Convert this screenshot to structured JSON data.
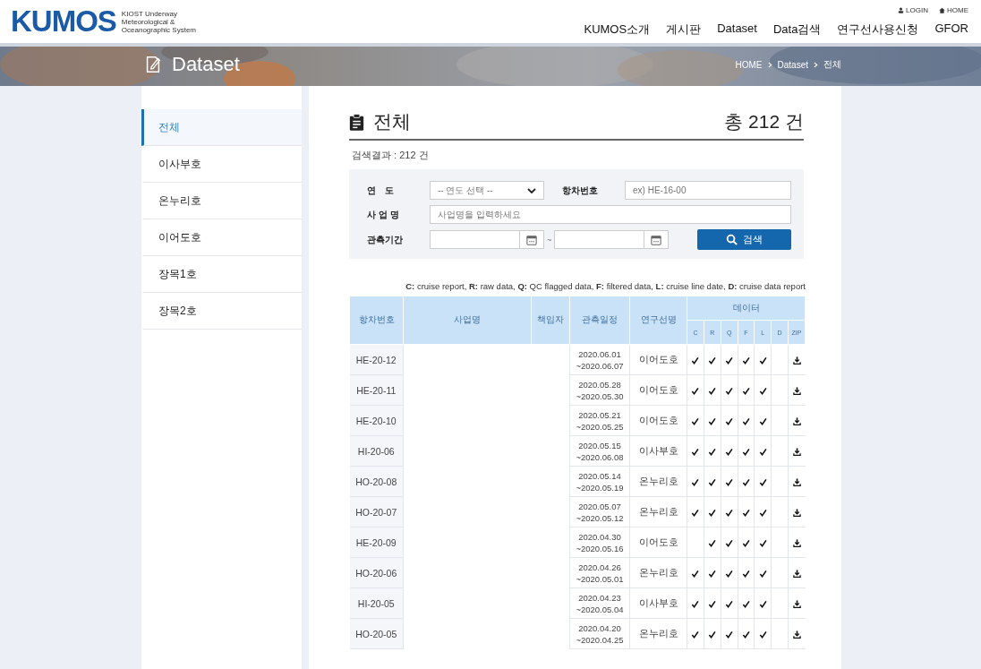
{
  "header": {
    "logo": "KUMOS",
    "logo_subtitle": [
      "KIOST Underway",
      "Meteorological &",
      "Oceanographic System"
    ],
    "top_links": [
      "LOGIN",
      "HOME"
    ],
    "nav": [
      "KUMOS소개",
      "게시판",
      "Dataset",
      "Data검색",
      "연구선사용신청",
      "GFOR"
    ]
  },
  "banner": {
    "title": "Dataset",
    "breadcrumb": [
      "HOME",
      "Dataset",
      "전체"
    ]
  },
  "sidebar": {
    "items": [
      {
        "label": "전체",
        "selected": true
      },
      {
        "label": "이사부호",
        "selected": false
      },
      {
        "label": "온누리호",
        "selected": false
      },
      {
        "label": "이어도호",
        "selected": false
      },
      {
        "label": "장목1호",
        "selected": false
      },
      {
        "label": "장목2호",
        "selected": false
      }
    ]
  },
  "page": {
    "title": "전체",
    "total": "총 212 건",
    "result_count": "검색결과 : 212 건"
  },
  "search": {
    "year_label": "연　도",
    "year_select": "-- 연도 선택 --",
    "cruise_label": "항차번호",
    "cruise_placeholder": "ex) HE-16-00",
    "project_label": "사 업 명",
    "project_placeholder": "사업명을 입력하세요",
    "period_label": "관측기간",
    "range_sep": "~",
    "button": "검색"
  },
  "legend": "**C:** cruise report, **R:** raw data, **Q:** QC flagged data, **F:** filtered data, **L:** cruise line date, **D:** cruise data report",
  "table": {
    "columns": [
      "항차번호",
      "사업명",
      "책임자",
      "관측일정",
      "연구선명"
    ],
    "group_header": "데이터",
    "sub_columns": [
      "C",
      "R",
      "Q",
      "F",
      "L",
      "D",
      "ZIP"
    ],
    "rows": [
      {
        "cruise": "HE-20-12",
        "start": "2020.06.01",
        "end": "~2020.06.07",
        "vessel": "이어도호",
        "c": true,
        "r": true,
        "q": true,
        "f": true,
        "l": true,
        "d": false
      },
      {
        "cruise": "HE-20-11",
        "start": "2020.05.28",
        "end": "~2020.05.30",
        "vessel": "이어도호",
        "c": true,
        "r": true,
        "q": true,
        "f": true,
        "l": true,
        "d": false
      },
      {
        "cruise": "HE-20-10",
        "start": "2020.05.21",
        "end": "~2020.05.25",
        "vessel": "이어도호",
        "c": true,
        "r": true,
        "q": true,
        "f": true,
        "l": true,
        "d": false
      },
      {
        "cruise": "HI-20-06",
        "start": "2020.05.15",
        "end": "~2020.06.08",
        "vessel": "이사부호",
        "c": true,
        "r": true,
        "q": true,
        "f": true,
        "l": true,
        "d": false
      },
      {
        "cruise": "HO-20-08",
        "start": "2020.05.14",
        "end": "~2020.05.19",
        "vessel": "온누리호",
        "c": true,
        "r": true,
        "q": true,
        "f": true,
        "l": true,
        "d": false
      },
      {
        "cruise": "HO-20-07",
        "start": "2020.05.07",
        "end": "~2020.05.12",
        "vessel": "온누리호",
        "c": true,
        "r": true,
        "q": true,
        "f": true,
        "l": true,
        "d": false
      },
      {
        "cruise": "HE-20-09",
        "start": "2020.04.30",
        "end": "~2020.05.16",
        "vessel": "이어도호",
        "c": false,
        "r": true,
        "q": true,
        "f": true,
        "l": true,
        "d": false
      },
      {
        "cruise": "HO-20-06",
        "start": "2020.04.26",
        "end": "~2020.05.01",
        "vessel": "온누리호",
        "c": true,
        "r": true,
        "q": true,
        "f": true,
        "l": true,
        "d": false
      },
      {
        "cruise": "HI-20-05",
        "start": "2020.04.23",
        "end": "~2020.05.04",
        "vessel": "이사부호",
        "c": true,
        "r": true,
        "q": true,
        "f": true,
        "l": true,
        "d": false
      },
      {
        "cruise": "HO-20-05",
        "start": "2020.04.20",
        "end": "~2020.04.25",
        "vessel": "온누리호",
        "c": true,
        "r": true,
        "q": true,
        "f": true,
        "l": true,
        "d": false
      }
    ]
  }
}
